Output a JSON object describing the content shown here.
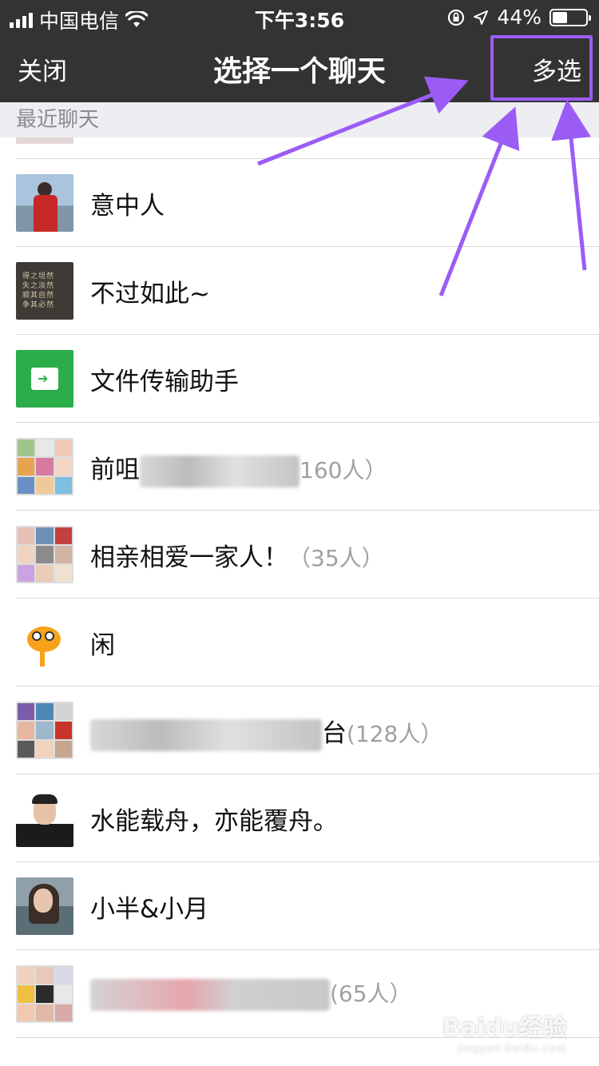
{
  "status_bar": {
    "carrier": "中国电信",
    "time": "下午3:56",
    "battery": "44%",
    "battery_level": 0.44
  },
  "nav": {
    "close_label": "关闭",
    "title": "选择一个聊天",
    "multi_select_label": "多选"
  },
  "section": {
    "header": "最近聊天"
  },
  "chats": [
    {
      "name": "意中人",
      "count": "",
      "avatar": "couple-photo"
    },
    {
      "name": "不过如此~",
      "count": "",
      "avatar": "text-poster",
      "avatar_text": [
        "得之坦然",
        "失之淡然",
        "顺其自然",
        "争其必然"
      ]
    },
    {
      "name": "文件传输助手",
      "count": "",
      "avatar": "file-transfer-icon"
    },
    {
      "name": "前咀",
      "count": "160人）",
      "avatar": "group-grid"
    },
    {
      "name": "相亲相爱一家人！",
      "count": "（35人）",
      "avatar": "group-grid"
    },
    {
      "name": "闲",
      "count": "",
      "avatar": "cartoon-bird"
    },
    {
      "name": "台",
      "count": "(128人）",
      "avatar": "group-grid"
    },
    {
      "name": "水能载舟，亦能覆舟。",
      "count": "",
      "avatar": "man-photo"
    },
    {
      "name": "小半&小月",
      "count": "",
      "avatar": "girl-photo"
    },
    {
      "name": "",
      "count": "(65人）",
      "avatar": "group-grid"
    }
  ],
  "watermark": {
    "brand": "Baidu经验",
    "url": "jingyan.baidu.com"
  },
  "colors": {
    "nav_background": "#333333",
    "section_background": "#ededf2",
    "annotation": "#9b5cf6",
    "file_icon_green": "#2bad4a"
  }
}
